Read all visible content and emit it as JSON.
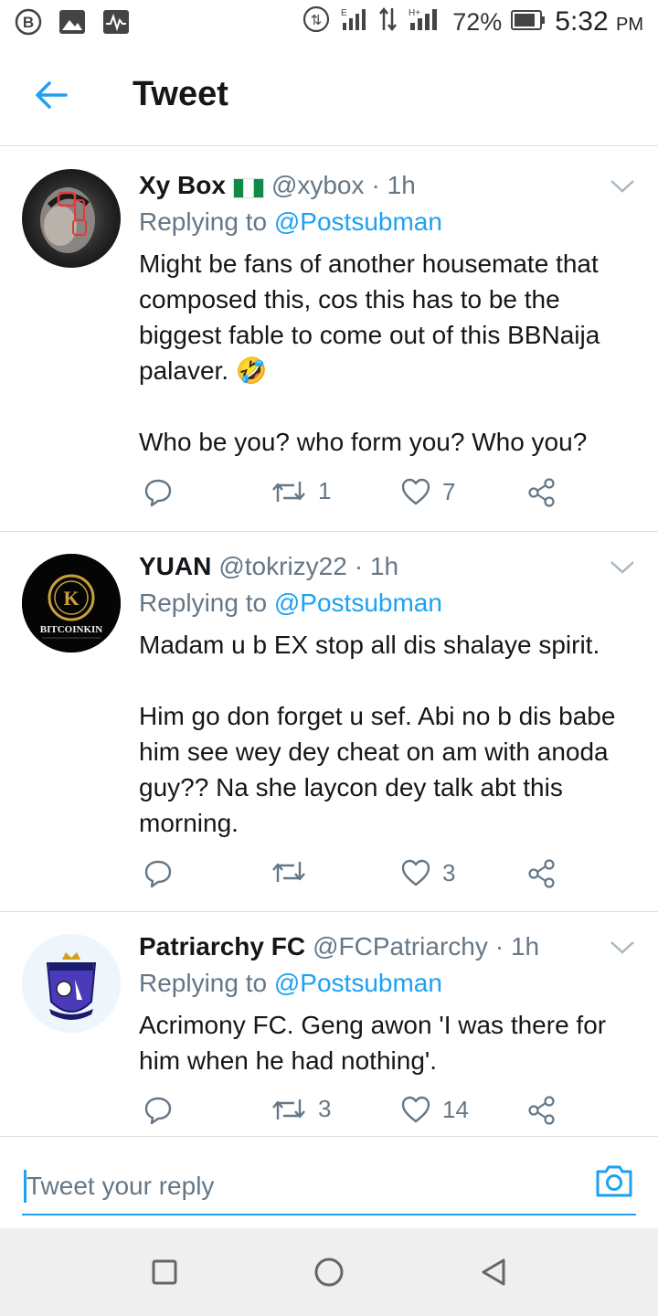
{
  "status_bar": {
    "battery": "72%",
    "time": "5:32",
    "ampm": "PM",
    "icons": [
      "b-circle-icon",
      "image-icon",
      "pulse-icon",
      "hotspot-icon",
      "signal-e-icon",
      "data-arrows-icon",
      "signal-h-icon",
      "battery-icon"
    ]
  },
  "header": {
    "title": "Tweet",
    "back_icon": "arrow-left-icon"
  },
  "colors": {
    "accent": "#1da1f2",
    "muted": "#657786",
    "text": "#14171a"
  },
  "tweets": [
    {
      "name": "Xy Box",
      "flag": "nigeria-flag",
      "handle": "@xybox",
      "time": "· 1h",
      "replying_prefix": "Replying to",
      "replying_to": "@Postsubman",
      "text": [
        "Might be fans of another housemate that composed this, cos this has to be the biggest fable to come out of this BBNaija palaver. 🤣",
        "Who be you? who form you? Who you?"
      ],
      "retweets": "1",
      "likes": "7"
    },
    {
      "name": "YUAN",
      "handle": "@tokrizy22",
      "time": "· 1h",
      "replying_prefix": "Replying to",
      "replying_to": "@Postsubman",
      "avatar_text": "BITCOINKIN",
      "text": [
        "Madam u b EX stop all dis shalaye spirit.",
        "Him go don forget u sef. Abi no b dis babe him see wey dey cheat on am with anoda guy?? Na she laycon dey talk abt this morning."
      ],
      "retweets": "",
      "likes": "3"
    },
    {
      "name": "Patriarchy FC",
      "handle": "@FCPatriarchy",
      "time": "· 1h",
      "replying_prefix": "Replying to",
      "replying_to": "@Postsubman",
      "text": [
        "Acrimony FC. Geng awon 'I was there for him when he had nothing'."
      ],
      "retweets": "3",
      "likes": "14"
    }
  ],
  "reply": {
    "placeholder": "Tweet your reply"
  }
}
